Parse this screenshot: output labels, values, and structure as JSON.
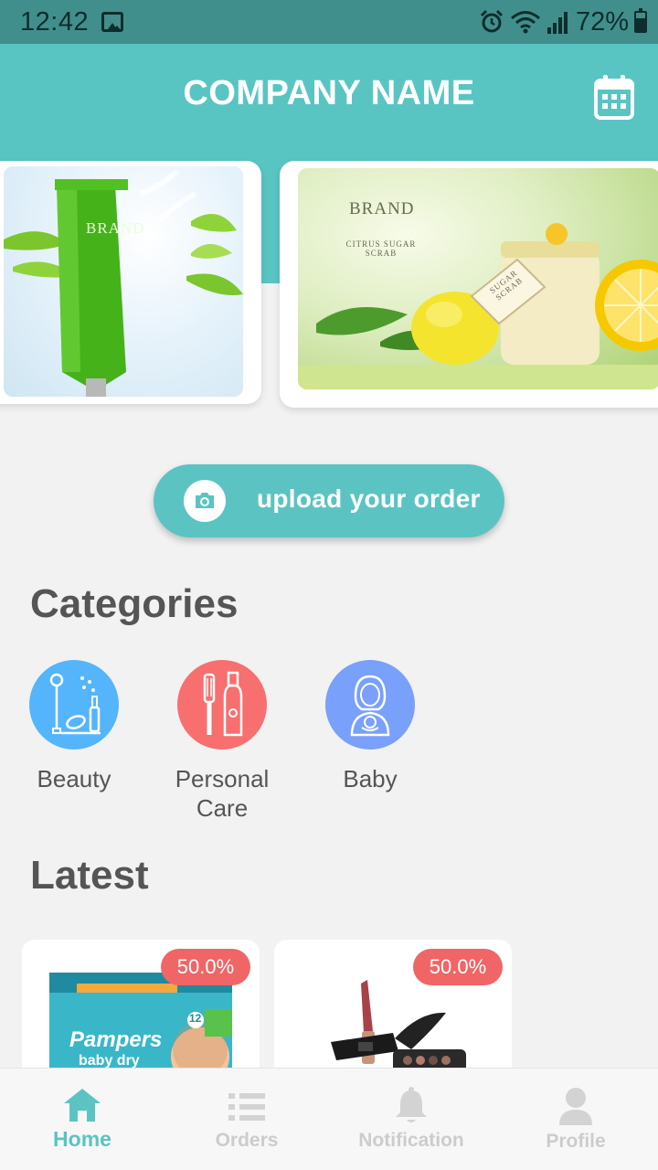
{
  "status_bar": {
    "time": "12:42",
    "battery": "72%",
    "icons": [
      "gallery-icon",
      "alarm-icon",
      "wifi-icon",
      "signal-icon",
      "battery-icon"
    ]
  },
  "header": {
    "title": "COMPANY NAME",
    "action_icon": "calendar-icon",
    "background": "#59c5c3"
  },
  "banners": [
    {
      "brand": "BRAND"
    },
    {
      "brand": "BRAND",
      "subtitle": "CITRUS SUGAR SCRAB",
      "tag": "SUGAR SCRAB"
    }
  ],
  "upload": {
    "label": "upload your order",
    "icon": "camera-icon"
  },
  "categories": {
    "title": "Categories",
    "items": [
      {
        "label": "Beauty",
        "icon": "cosmetics-icon",
        "color": "#54b5fc"
      },
      {
        "label": "Personal Care",
        "icon": "toothbrush-icon",
        "color": "#f76f6f"
      },
      {
        "label": "Baby",
        "icon": "mother-baby-icon",
        "color": "#79a0fa"
      }
    ]
  },
  "latest": {
    "title": "Latest",
    "products": [
      {
        "discount": "50.0%",
        "brand": "Pampers",
        "sub": "baby dry",
        "count": "12"
      },
      {
        "discount": "50.0%",
        "image": "makeup-products"
      }
    ]
  },
  "bottom_nav": {
    "active_color": "#5bc4c2",
    "items": [
      {
        "label": "Home",
        "icon": "home-icon"
      },
      {
        "label": "Orders",
        "icon": "list-icon"
      },
      {
        "label": "Notification",
        "icon": "bell-icon"
      },
      {
        "label": "Profile",
        "icon": "user-icon"
      }
    ]
  }
}
